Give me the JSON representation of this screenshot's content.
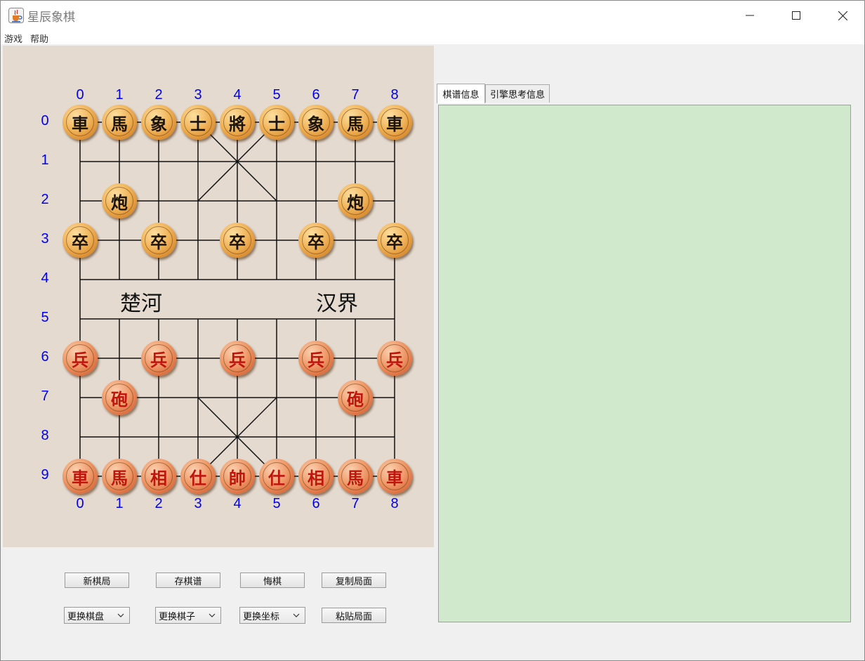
{
  "window": {
    "title": "星辰象棋",
    "app_icon": "java-cup-icon"
  },
  "menu": [
    {
      "label": "游戏"
    },
    {
      "label": "帮助"
    }
  ],
  "board": {
    "col_labels": [
      "0",
      "1",
      "2",
      "3",
      "4",
      "5",
      "6",
      "7",
      "8"
    ],
    "row_labels": [
      "0",
      "1",
      "2",
      "3",
      "4",
      "5",
      "6",
      "7",
      "8",
      "9"
    ],
    "river_left": "楚河",
    "river_right": "汉界",
    "background": "#e4dad0",
    "coord_color": "#0000ee",
    "pieces": [
      {
        "t": "車",
        "c": "black",
        "col": 0,
        "row": 0
      },
      {
        "t": "馬",
        "c": "black",
        "col": 1,
        "row": 0
      },
      {
        "t": "象",
        "c": "black",
        "col": 2,
        "row": 0
      },
      {
        "t": "士",
        "c": "black",
        "col": 3,
        "row": 0
      },
      {
        "t": "將",
        "c": "black",
        "col": 4,
        "row": 0
      },
      {
        "t": "士",
        "c": "black",
        "col": 5,
        "row": 0
      },
      {
        "t": "象",
        "c": "black",
        "col": 6,
        "row": 0
      },
      {
        "t": "馬",
        "c": "black",
        "col": 7,
        "row": 0
      },
      {
        "t": "車",
        "c": "black",
        "col": 8,
        "row": 0
      },
      {
        "t": "炮",
        "c": "black",
        "col": 1,
        "row": 2
      },
      {
        "t": "炮",
        "c": "black",
        "col": 7,
        "row": 2
      },
      {
        "t": "卒",
        "c": "black",
        "col": 0,
        "row": 3
      },
      {
        "t": "卒",
        "c": "black",
        "col": 2,
        "row": 3
      },
      {
        "t": "卒",
        "c": "black",
        "col": 4,
        "row": 3
      },
      {
        "t": "卒",
        "c": "black",
        "col": 6,
        "row": 3
      },
      {
        "t": "卒",
        "c": "black",
        "col": 8,
        "row": 3
      },
      {
        "t": "兵",
        "c": "red",
        "col": 0,
        "row": 6
      },
      {
        "t": "兵",
        "c": "red",
        "col": 2,
        "row": 6
      },
      {
        "t": "兵",
        "c": "red",
        "col": 4,
        "row": 6
      },
      {
        "t": "兵",
        "c": "red",
        "col": 6,
        "row": 6
      },
      {
        "t": "兵",
        "c": "red",
        "col": 8,
        "row": 6
      },
      {
        "t": "砲",
        "c": "red",
        "col": 1,
        "row": 7
      },
      {
        "t": "砲",
        "c": "red",
        "col": 7,
        "row": 7
      },
      {
        "t": "車",
        "c": "red",
        "col": 0,
        "row": 9
      },
      {
        "t": "馬",
        "c": "red",
        "col": 1,
        "row": 9
      },
      {
        "t": "相",
        "c": "red",
        "col": 2,
        "row": 9
      },
      {
        "t": "仕",
        "c": "red",
        "col": 3,
        "row": 9
      },
      {
        "t": "帥",
        "c": "red",
        "col": 4,
        "row": 9
      },
      {
        "t": "仕",
        "c": "red",
        "col": 5,
        "row": 9
      },
      {
        "t": "相",
        "c": "red",
        "col": 6,
        "row": 9
      },
      {
        "t": "馬",
        "c": "red",
        "col": 7,
        "row": 9
      },
      {
        "t": "車",
        "c": "red",
        "col": 8,
        "row": 9
      }
    ]
  },
  "controls": {
    "new_game": "新棋局",
    "save_record": "存棋谱",
    "undo": "悔棋",
    "copy_position": "复制局面",
    "change_board": "更换棋盘",
    "change_pieces": "更换棋子",
    "change_coords": "更换坐标",
    "paste_position": "粘贴局面"
  },
  "tabs": [
    {
      "label": "棋谱信息",
      "active": true
    },
    {
      "label": "引擎思考信息",
      "active": false
    }
  ],
  "info_panel": {
    "background": "#d0e9cc"
  }
}
